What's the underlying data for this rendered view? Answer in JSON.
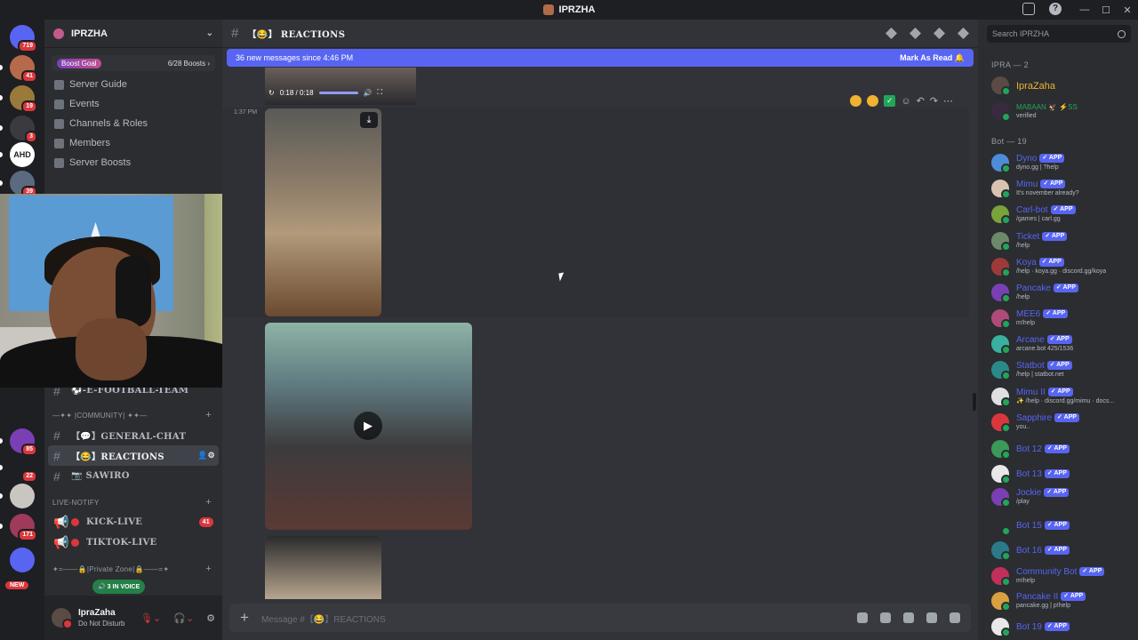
{
  "window": {
    "title": "IPRZHA",
    "controls": [
      "—",
      "☐",
      "✕"
    ]
  },
  "guilds": [
    {
      "name": "home",
      "color": "#5865f2",
      "badge": "719"
    },
    {
      "name": "server-1",
      "color": "#b66a4a",
      "badge": "41"
    },
    {
      "name": "server-2",
      "color": "#9a7a3a",
      "badge": "19"
    },
    {
      "name": "server-3",
      "color": "#3a3a40",
      "badge": "3"
    },
    {
      "name": "AHD",
      "color": "#ffffff",
      "badge": ""
    },
    {
      "name": "server-5",
      "color": "#5a6a80",
      "badge": "39"
    },
    {
      "name": "server-6",
      "color": "#4d7ac8",
      "badge": ""
    },
    {
      "name": "server-7",
      "color": "#7a3fb5",
      "badge": "85"
    },
    {
      "name": "server-8",
      "color": "#1e1f22",
      "badge": "22"
    },
    {
      "name": "server-9",
      "color": "#c9c5c0",
      "badge": ""
    },
    {
      "name": "server-10",
      "color": "#a03a5a",
      "badge": "171"
    },
    {
      "name": "server-11",
      "color": "#5865f2",
      "badge": ""
    }
  ],
  "new_badge": "NEW",
  "server": {
    "name": "IPRZHA",
    "boost_label": "Boost Goal",
    "boost_count": "6/28 Boosts"
  },
  "nav": [
    "Server Guide",
    "Events",
    "Channels & Roles",
    "Members",
    "Server Boosts"
  ],
  "channels": {
    "efootball": "⚽-E-FOOTBALL-TEAM",
    "community_cat": "—✦✦ |COMMUNITY| ✦✦—",
    "general": "【💬】GENERAL-CHAT",
    "reactions": "【😂】REACTIONS",
    "sawiro": "📷 SAWIRO",
    "live_cat": "LIVE-NOTIFY",
    "kick": "KICK-LIVE",
    "kick_badge": "41",
    "tiktok": "TIKTOK-LIVE",
    "private_cat": "✦=——🔒|Private Zone|🔒——=✦"
  },
  "voice": {
    "label": "3 IN VOICE"
  },
  "user": {
    "name": "IpraZaha",
    "status": "Do Not Disturb"
  },
  "header": {
    "channel": "【😂】 REACTIONS"
  },
  "newbar": {
    "text": "36 new messages since 4:46 PM",
    "action": "Mark As Read"
  },
  "video": {
    "time": "0:18 / 0:18"
  },
  "message": {
    "timestamp": "1:37 PM"
  },
  "composer": {
    "placeholder": "Message #【😂】REACTIONS"
  },
  "search": {
    "placeholder": "Search IPRZHA"
  },
  "members": {
    "group1": "IPRA — 2",
    "owner": {
      "name": "IpraZaha",
      "color": "#f0b232"
    },
    "second": {
      "name": "MABAAN 🦅 ⚡SS",
      "status": "verified"
    },
    "group2": "Bot — 19",
    "bots": [
      {
        "name": "Dyno",
        "status": "dyno.gg | ?help",
        "color": "#4d8cd8"
      },
      {
        "name": "Mimu",
        "status": "It's november already?",
        "color": "#d9c3b0"
      },
      {
        "name": "Carl-bot",
        "status": "/games | carl.gg",
        "color": "#7aa33a"
      },
      {
        "name": "Ticket",
        "status": "/help",
        "color": "#6a8a6a"
      },
      {
        "name": "Koya",
        "status": "/help · koya.gg · discord.gg/koya",
        "color": "#a03a3a"
      },
      {
        "name": "Pancake",
        "status": "/help",
        "color": "#7a3fb5"
      },
      {
        "name": "MEE6",
        "status": "m!help",
        "color": "#b04a7a"
      },
      {
        "name": "Arcane",
        "status": "arcane.bot 425/1536",
        "color": "#3ab0a0"
      },
      {
        "name": "Statbot",
        "status": "/help | statbot.net",
        "color": "#2a8a8a"
      },
      {
        "name": "Mimu II",
        "status": "✨ /help · discord.gg/mimu · docs...",
        "color": "#e0e0e0"
      },
      {
        "name": "Sapphire",
        "status": "you..",
        "color": "#da373c"
      },
      {
        "name": "Bot 12",
        "status": "",
        "color": "#3a9a5a"
      },
      {
        "name": "Bot 13",
        "status": "",
        "color": "#e8e8e8"
      },
      {
        "name": "Jockie",
        "status": "/play",
        "color": "#7a3fb5"
      },
      {
        "name": "Bot 15",
        "status": "",
        "color": "#2b2d31"
      },
      {
        "name": "Bot 16",
        "status": "",
        "color": "#2a7a8a"
      },
      {
        "name": "Community Bot",
        "status": "m!help",
        "color": "#c0305a"
      },
      {
        "name": "Pancake II",
        "status": "pancake.gg | p!help",
        "color": "#d8a040"
      },
      {
        "name": "Bot 19",
        "status": "",
        "color": "#e8e8e8"
      }
    ]
  }
}
